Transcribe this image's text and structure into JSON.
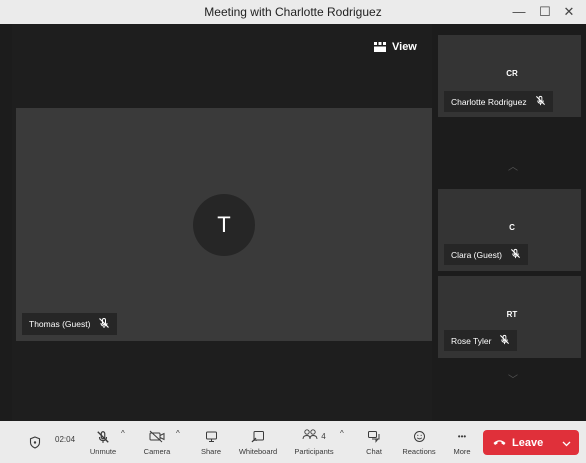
{
  "window": {
    "title": "Meeting with Charlotte Rodriguez",
    "minimize": "—",
    "maximize": "☐",
    "close": "✕"
  },
  "stage": {
    "view_label": "View",
    "main_participant": {
      "initial": "T",
      "name": "Thomas (Guest)",
      "muted": true
    }
  },
  "side": {
    "participants": [
      {
        "initials": "CR",
        "name": "Charlotte Rodriguez",
        "muted": true
      },
      {
        "initials": "C",
        "name": "Clara (Guest)",
        "muted": true
      },
      {
        "initials": "RT",
        "name": "Rose Tyler",
        "muted": true
      }
    ],
    "scroll_up": "︿",
    "scroll_down": "﹀"
  },
  "toolbar": {
    "timer": "02:04",
    "unmute": "Unmute",
    "camera": "Camera",
    "share": "Share",
    "whiteboard": "Whiteboard",
    "participants": "Participants",
    "participants_count": "4",
    "chat": "Chat",
    "reactions": "Reactions",
    "more": "More",
    "more_icon": "•••",
    "leave": "Leave",
    "caret": "^"
  },
  "colors": {
    "leave": "#e0303a",
    "toolbar_bg": "#ebebeb",
    "tile_bg": "#3a3a3a"
  }
}
